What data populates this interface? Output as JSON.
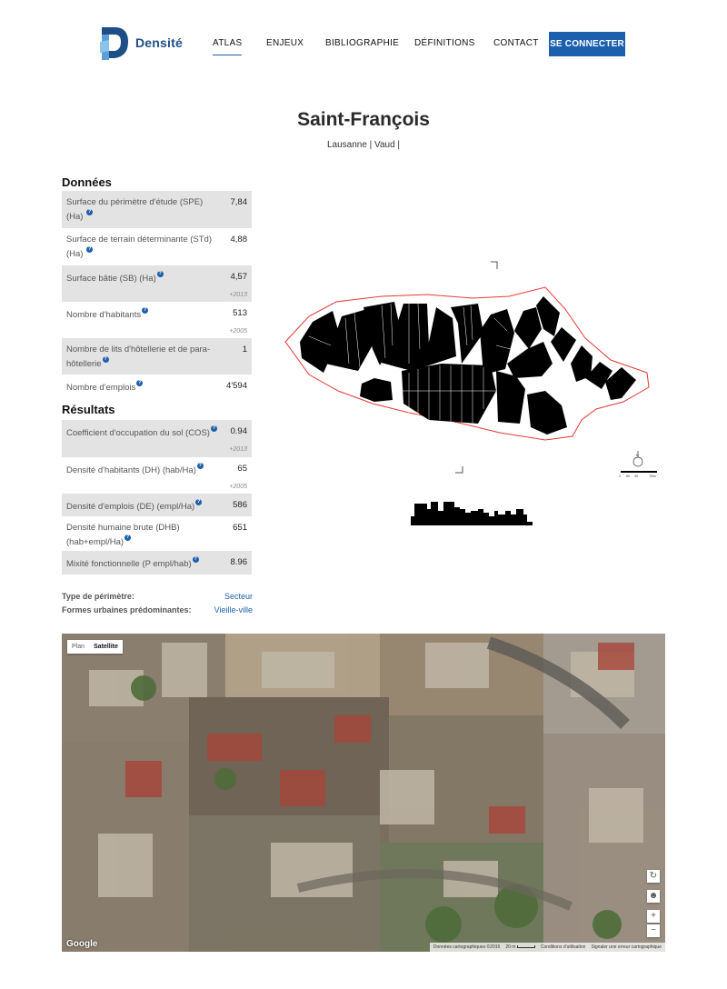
{
  "brand": {
    "name": "Densité",
    "accent": "#1b5fad"
  },
  "nav": {
    "items": [
      {
        "label": "ATLAS",
        "active": true
      },
      {
        "label": "ENJEUX"
      },
      {
        "label": "BIBLIOGRAPHIE"
      },
      {
        "label": "DÉFINITIONS"
      },
      {
        "label": "CONTACT"
      }
    ],
    "connect_label": "SE CONNECTER"
  },
  "page": {
    "title": "Saint-François",
    "subtitle": "Lausanne | Vaud |"
  },
  "donnees": {
    "title": "Données",
    "rows": [
      {
        "label": "Surface du périmètre d'étude (SPE) (Ha)",
        "value": "7,84",
        "year": ""
      },
      {
        "label": "Surface de terrain déterminante (STd) (Ha)",
        "value": "4,88",
        "year": ""
      },
      {
        "label": "Surface bâtie (SB) (Ha)",
        "value": "4,57",
        "year": "+2013"
      },
      {
        "label": "Nombre d'habitants",
        "value": "513",
        "year": "+2005"
      },
      {
        "label": "Nombre de lits d'hôtellerie et de para-hôtellerie",
        "value": "1",
        "year": ""
      },
      {
        "label": "Nombre d'emplois",
        "value": "4'594",
        "year": ""
      }
    ]
  },
  "resultats": {
    "title": "Résultats",
    "rows": [
      {
        "label": "Coefficient d'occupation du sol (COS)",
        "value": "0.94",
        "year": "+2013"
      },
      {
        "label": "Densité d'habitants (DH) (hab/Ha)",
        "value": "65",
        "year": "+2005"
      },
      {
        "label": "Densité d'emplois (DE) (empl/Ha)",
        "value": "586",
        "year": ""
      },
      {
        "label": "Densité humaine brute (DHB) (hab+empl/Ha)",
        "value": "651",
        "year": ""
      },
      {
        "label": "Mixité fonctionnelle (P empl/hab)",
        "value": "8.96",
        "year": ""
      }
    ]
  },
  "meta": {
    "type_label": "Type de périmètre:",
    "type_value": "Secteur",
    "formes_label": "Formes urbaines prédominantes:",
    "formes_value": "Vieille-ville"
  },
  "map": {
    "plan_label": "Plan",
    "satellite_label": "Satellite",
    "google": "Google",
    "footer_data": "Données cartographiques ©2016",
    "footer_scale": "20 m",
    "footer_terms": "Conditions d'utilisation",
    "footer_report": "Signaler une erreur cartographique",
    "zoom_in": "+",
    "zoom_out": "−"
  },
  "plan": {
    "scale_labels": [
      "0",
      "50",
      "30",
      "50m"
    ],
    "north": "N"
  }
}
